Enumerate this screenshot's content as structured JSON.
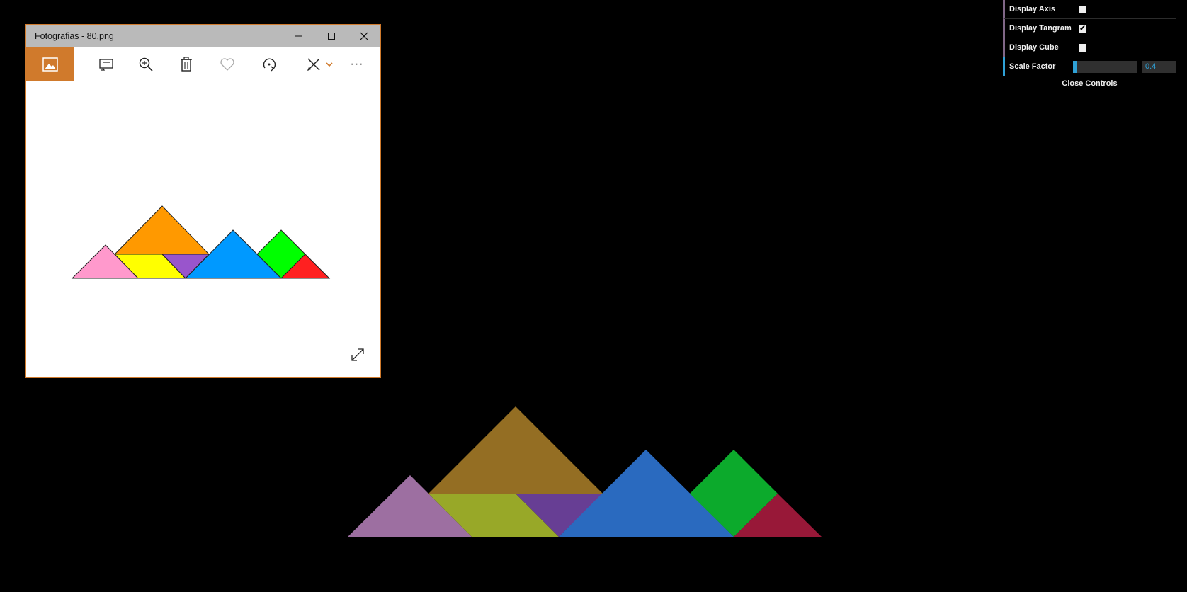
{
  "window": {
    "title": "Fotografias - 80.png"
  },
  "toolbar": {
    "items": [
      {
        "name": "image-icon"
      },
      {
        "name": "slideshow-icon"
      },
      {
        "name": "zoom-icon"
      },
      {
        "name": "delete-icon"
      },
      {
        "name": "heart-icon"
      },
      {
        "name": "rotate-icon"
      },
      {
        "name": "edit-icon"
      },
      {
        "name": "more-icon",
        "label": "···"
      }
    ]
  },
  "photo_colors": {
    "pink": "#ff99cc",
    "orange": "#ff9900",
    "yellow": "#ffff00",
    "purple": "#9955cc",
    "blue": "#0099ff",
    "green": "#00ff00",
    "red": "#ff2020"
  },
  "scene_colors": {
    "pink": "#9d6fa1",
    "orange": "#946e23",
    "yellow": "#98a828",
    "purple": "#673e94",
    "blue": "#2a6abf",
    "green": "#0caa2c",
    "red": "#981838"
  },
  "controls": {
    "display_axis": {
      "label": "Display Axis",
      "checked": false
    },
    "display_tangram": {
      "label": "Display Tangram",
      "checked": true
    },
    "display_cube": {
      "label": "Display Cube",
      "checked": false
    },
    "scale_factor": {
      "label": "Scale Factor",
      "value": "0.4",
      "fraction": 0.04
    },
    "close_label": "Close Controls"
  },
  "accent": "#d07a2c"
}
